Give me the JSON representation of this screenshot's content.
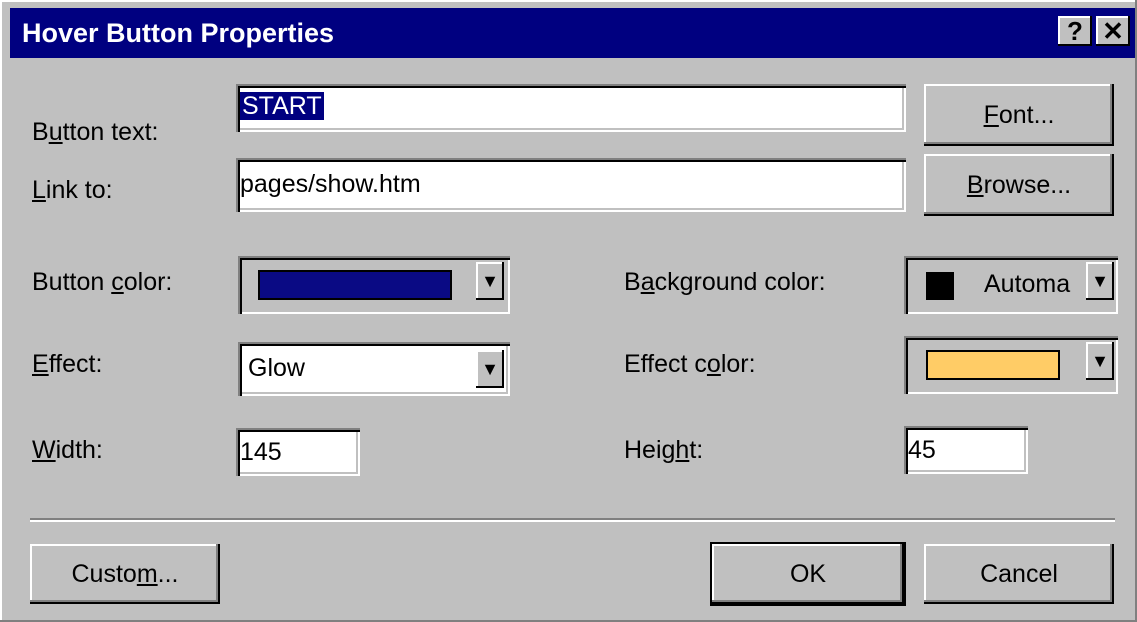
{
  "window": {
    "title": "Hover Button Properties",
    "help_label": "?",
    "close_label": "✕"
  },
  "fields": {
    "button_text": {
      "label_pre": "B",
      "label_u": "u",
      "label_post": "tton text:",
      "value": "START"
    },
    "link_to": {
      "label_pre": "",
      "label_u": "L",
      "label_post": "ink to:",
      "value": "pages/show.htm"
    },
    "button_color": {
      "label_pre": "Button ",
      "label_u": "c",
      "label_post": "olor:",
      "color": "#0a0a84"
    },
    "effect": {
      "label_pre": "",
      "label_u": "E",
      "label_post": "ffect:",
      "value": "Glow"
    },
    "width": {
      "label_pre": "",
      "label_u": "W",
      "label_post": "idth:",
      "value": "145"
    },
    "background_color": {
      "label_pre": "B",
      "label_u": "a",
      "label_post": "ckground color:",
      "value": "Automa",
      "color": "#000000"
    },
    "effect_color": {
      "label_pre": "Effect c",
      "label_u": "o",
      "label_post": "lor:",
      "color": "#ffcc66"
    },
    "height": {
      "label_pre": "Heig",
      "label_u": "h",
      "label_post": "t:",
      "value": "45"
    }
  },
  "buttons": {
    "font": {
      "pre": "",
      "u": "F",
      "post": "ont..."
    },
    "browse": {
      "pre": "",
      "u": "B",
      "post": "rowse..."
    },
    "custom": {
      "pre": "Custo",
      "u": "m",
      "post": "..."
    },
    "ok": "OK",
    "cancel": "Cancel"
  },
  "icons": {
    "dropdown": "triangle-down"
  }
}
